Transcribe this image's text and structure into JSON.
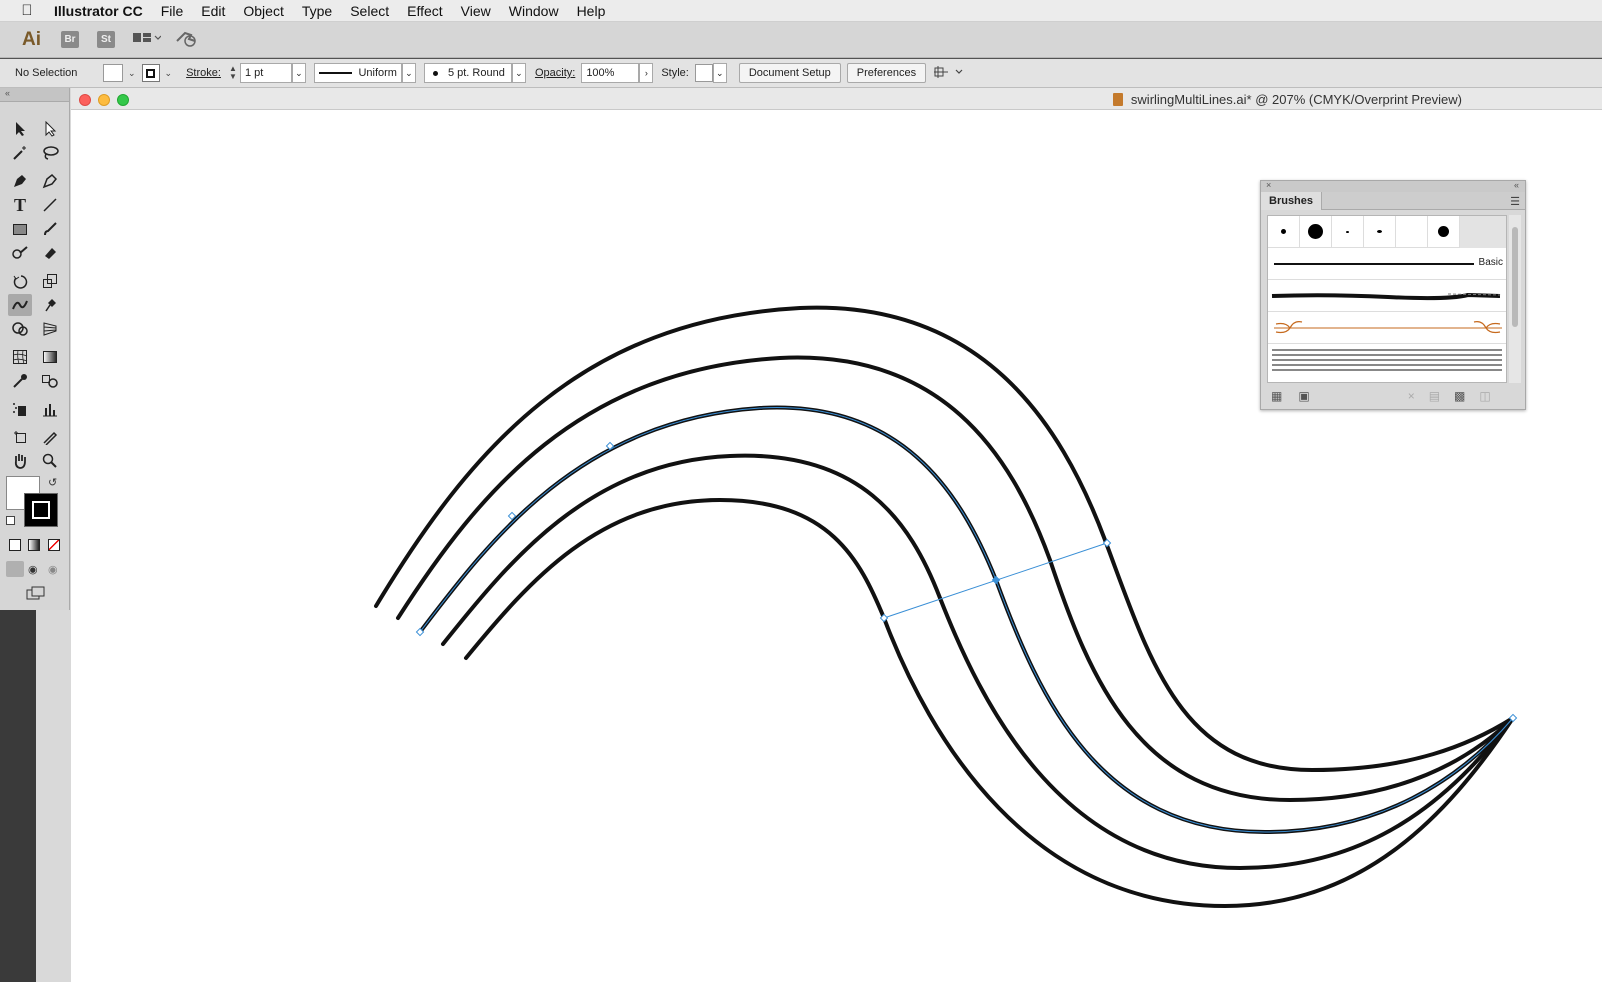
{
  "menubar": {
    "app_name": "Illustrator CC",
    "items": [
      "File",
      "Edit",
      "Object",
      "Type",
      "Select",
      "Effect",
      "View",
      "Window",
      "Help"
    ]
  },
  "appbar": {
    "logo": "Ai",
    "bridge": "Br",
    "stock": "St"
  },
  "control": {
    "selection_status": "No Selection",
    "stroke_label": "Stroke:",
    "stroke_weight": "1 pt",
    "profile": "Uniform",
    "brush": "5 pt. Round",
    "opacity_label": "Opacity:",
    "opacity": "100%",
    "style_label": "Style:",
    "document_setup": "Document Setup",
    "preferences": "Preferences"
  },
  "document": {
    "title": "swirlingMultiLines.ai* @ 207% (CMYK/Overprint Preview)"
  },
  "brushes_panel": {
    "tab": "Brushes",
    "basic_label": "Basic"
  },
  "colors": {
    "selection": "#3a8fd6",
    "stroke": "#111111",
    "close": "#fc605c",
    "minimize": "#fdbc40",
    "zoom": "#34c84a"
  }
}
